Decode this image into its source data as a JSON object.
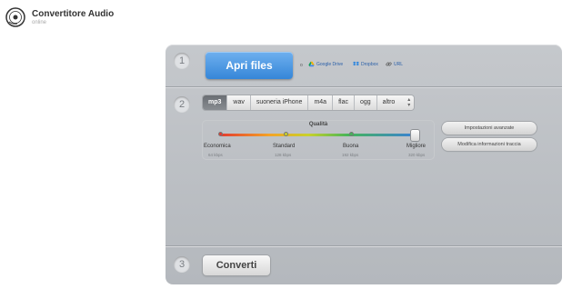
{
  "header": {
    "title": "Convertitore Audio",
    "subtitle": "online"
  },
  "steps": {
    "one": "1",
    "two": "2",
    "three": "3"
  },
  "open": {
    "button_label": "Apri files",
    "or_text": "o",
    "sources": {
      "google_drive": "Google Drive",
      "dropbox": "Dropbox",
      "url": "URL"
    }
  },
  "formats": {
    "selected": "mp3",
    "items": [
      "mp3",
      "wav",
      "suoneria iPhone",
      "m4a",
      "flac",
      "ogg"
    ],
    "more_label": "altro"
  },
  "quality": {
    "title": "Qualità",
    "selected_level": "Migliore",
    "levels": [
      {
        "label": "Economica",
        "bitrate": "64 kbps"
      },
      {
        "label": "Standard",
        "bitrate": "128 kbps"
      },
      {
        "label": "Buona",
        "bitrate": "192 kbps"
      },
      {
        "label": "Migliore",
        "bitrate": "320 kbps"
      }
    ],
    "dot_colors": [
      "#e33b30",
      "#c7d12b",
      "#45b55a"
    ]
  },
  "side_buttons": {
    "advanced": "Impostazioni avanzate",
    "edit_info": "Modifica informazioni traccia"
  },
  "convert": {
    "button_label": "Converti"
  },
  "colors": {
    "accent": "#3586d8",
    "panel": "#bcc0c4"
  }
}
